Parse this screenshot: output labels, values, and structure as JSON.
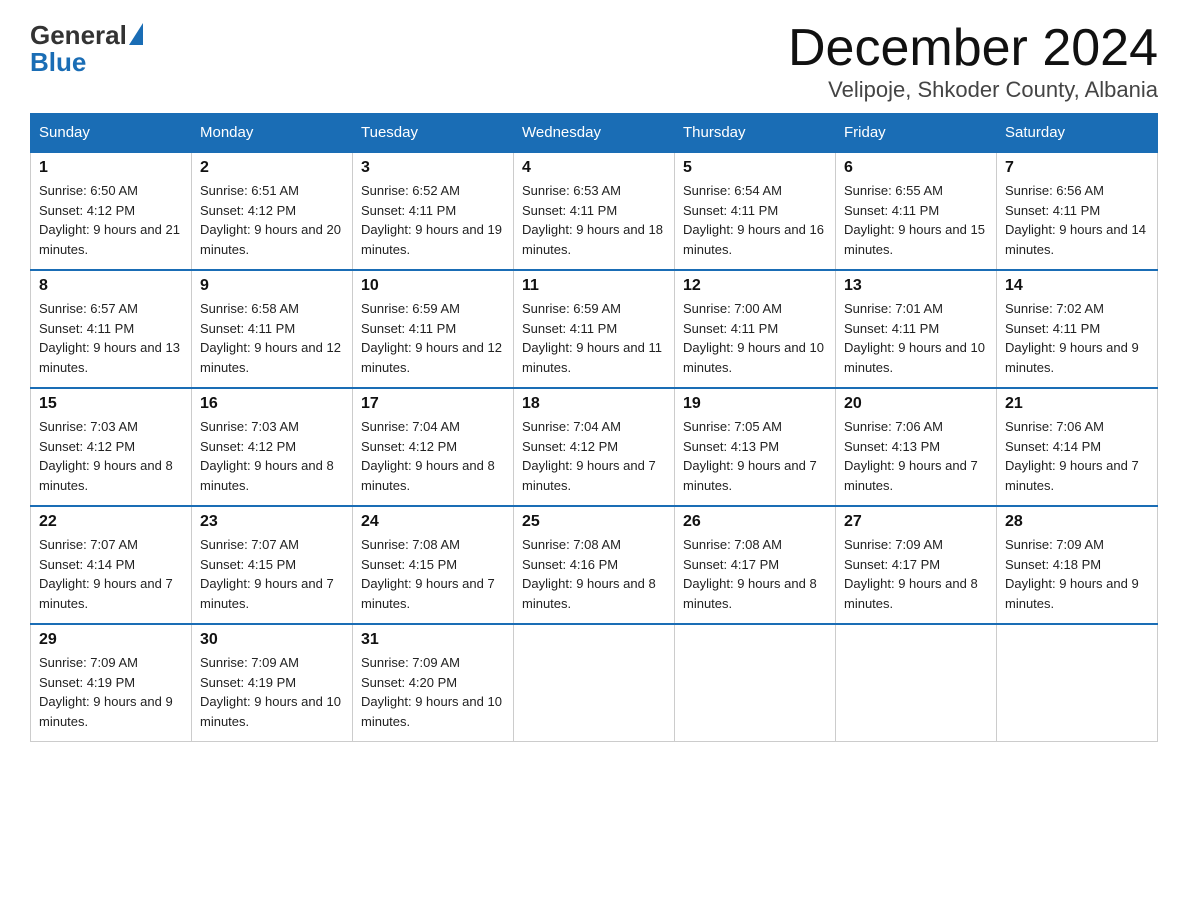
{
  "header": {
    "logo": {
      "general": "General",
      "blue": "Blue"
    },
    "title": "December 2024",
    "subtitle": "Velipoje, Shkoder County, Albania"
  },
  "weekdays": [
    "Sunday",
    "Monday",
    "Tuesday",
    "Wednesday",
    "Thursday",
    "Friday",
    "Saturday"
  ],
  "weeks": [
    [
      {
        "day": "1",
        "sunrise": "6:50 AM",
        "sunset": "4:12 PM",
        "daylight": "9 hours and 21 minutes."
      },
      {
        "day": "2",
        "sunrise": "6:51 AM",
        "sunset": "4:12 PM",
        "daylight": "9 hours and 20 minutes."
      },
      {
        "day": "3",
        "sunrise": "6:52 AM",
        "sunset": "4:11 PM",
        "daylight": "9 hours and 19 minutes."
      },
      {
        "day": "4",
        "sunrise": "6:53 AM",
        "sunset": "4:11 PM",
        "daylight": "9 hours and 18 minutes."
      },
      {
        "day": "5",
        "sunrise": "6:54 AM",
        "sunset": "4:11 PM",
        "daylight": "9 hours and 16 minutes."
      },
      {
        "day": "6",
        "sunrise": "6:55 AM",
        "sunset": "4:11 PM",
        "daylight": "9 hours and 15 minutes."
      },
      {
        "day": "7",
        "sunrise": "6:56 AM",
        "sunset": "4:11 PM",
        "daylight": "9 hours and 14 minutes."
      }
    ],
    [
      {
        "day": "8",
        "sunrise": "6:57 AM",
        "sunset": "4:11 PM",
        "daylight": "9 hours and 13 minutes."
      },
      {
        "day": "9",
        "sunrise": "6:58 AM",
        "sunset": "4:11 PM",
        "daylight": "9 hours and 12 minutes."
      },
      {
        "day": "10",
        "sunrise": "6:59 AM",
        "sunset": "4:11 PM",
        "daylight": "9 hours and 12 minutes."
      },
      {
        "day": "11",
        "sunrise": "6:59 AM",
        "sunset": "4:11 PM",
        "daylight": "9 hours and 11 minutes."
      },
      {
        "day": "12",
        "sunrise": "7:00 AM",
        "sunset": "4:11 PM",
        "daylight": "9 hours and 10 minutes."
      },
      {
        "day": "13",
        "sunrise": "7:01 AM",
        "sunset": "4:11 PM",
        "daylight": "9 hours and 10 minutes."
      },
      {
        "day": "14",
        "sunrise": "7:02 AM",
        "sunset": "4:11 PM",
        "daylight": "9 hours and 9 minutes."
      }
    ],
    [
      {
        "day": "15",
        "sunrise": "7:03 AM",
        "sunset": "4:12 PM",
        "daylight": "9 hours and 8 minutes."
      },
      {
        "day": "16",
        "sunrise": "7:03 AM",
        "sunset": "4:12 PM",
        "daylight": "9 hours and 8 minutes."
      },
      {
        "day": "17",
        "sunrise": "7:04 AM",
        "sunset": "4:12 PM",
        "daylight": "9 hours and 8 minutes."
      },
      {
        "day": "18",
        "sunrise": "7:04 AM",
        "sunset": "4:12 PM",
        "daylight": "9 hours and 7 minutes."
      },
      {
        "day": "19",
        "sunrise": "7:05 AM",
        "sunset": "4:13 PM",
        "daylight": "9 hours and 7 minutes."
      },
      {
        "day": "20",
        "sunrise": "7:06 AM",
        "sunset": "4:13 PM",
        "daylight": "9 hours and 7 minutes."
      },
      {
        "day": "21",
        "sunrise": "7:06 AM",
        "sunset": "4:14 PM",
        "daylight": "9 hours and 7 minutes."
      }
    ],
    [
      {
        "day": "22",
        "sunrise": "7:07 AM",
        "sunset": "4:14 PM",
        "daylight": "9 hours and 7 minutes."
      },
      {
        "day": "23",
        "sunrise": "7:07 AM",
        "sunset": "4:15 PM",
        "daylight": "9 hours and 7 minutes."
      },
      {
        "day": "24",
        "sunrise": "7:08 AM",
        "sunset": "4:15 PM",
        "daylight": "9 hours and 7 minutes."
      },
      {
        "day": "25",
        "sunrise": "7:08 AM",
        "sunset": "4:16 PM",
        "daylight": "9 hours and 8 minutes."
      },
      {
        "day": "26",
        "sunrise": "7:08 AM",
        "sunset": "4:17 PM",
        "daylight": "9 hours and 8 minutes."
      },
      {
        "day": "27",
        "sunrise": "7:09 AM",
        "sunset": "4:17 PM",
        "daylight": "9 hours and 8 minutes."
      },
      {
        "day": "28",
        "sunrise": "7:09 AM",
        "sunset": "4:18 PM",
        "daylight": "9 hours and 9 minutes."
      }
    ],
    [
      {
        "day": "29",
        "sunrise": "7:09 AM",
        "sunset": "4:19 PM",
        "daylight": "9 hours and 9 minutes."
      },
      {
        "day": "30",
        "sunrise": "7:09 AM",
        "sunset": "4:19 PM",
        "daylight": "9 hours and 10 minutes."
      },
      {
        "day": "31",
        "sunrise": "7:09 AM",
        "sunset": "4:20 PM",
        "daylight": "9 hours and 10 minutes."
      },
      null,
      null,
      null,
      null
    ]
  ]
}
